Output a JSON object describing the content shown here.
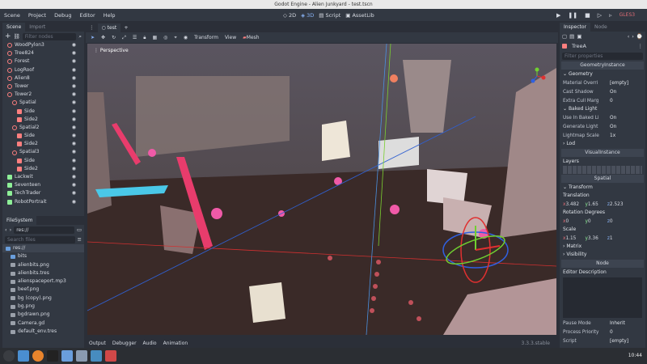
{
  "window": {
    "title": "Godot Engine - Alien Junkyard - test.tscn"
  },
  "menu": [
    "Scene",
    "Project",
    "Debug",
    "Editor",
    "Help"
  ],
  "modes": {
    "m2d": "2D",
    "m3d": "3D",
    "script": "Script",
    "assetlib": "AssetLib"
  },
  "renderer": "GLES3",
  "scene_dock": {
    "tab_scene": "Scene",
    "tab_import": "Import",
    "filter_placeholder": "Filter nodes",
    "nodes": [
      {
        "name": "WoodPylon3",
        "indent": 1,
        "icon": "spatial"
      },
      {
        "name": "Tree824",
        "indent": 1,
        "icon": "spatial"
      },
      {
        "name": "Forest",
        "indent": 1,
        "icon": "spatial"
      },
      {
        "name": "LogRoof",
        "indent": 1,
        "icon": "spatial"
      },
      {
        "name": "Alien8",
        "indent": 1,
        "icon": "spatial"
      },
      {
        "name": "Tower",
        "indent": 1,
        "icon": "spatial"
      },
      {
        "name": "Tower2",
        "indent": 1,
        "icon": "spatial"
      },
      {
        "name": "Spatial",
        "indent": 2,
        "icon": "spatial"
      },
      {
        "name": "Side",
        "indent": 3,
        "icon": "sprite"
      },
      {
        "name": "Side2",
        "indent": 3,
        "icon": "sprite"
      },
      {
        "name": "Spatial2",
        "indent": 2,
        "icon": "spatial"
      },
      {
        "name": "Side",
        "indent": 3,
        "icon": "sprite"
      },
      {
        "name": "Side2",
        "indent": 3,
        "icon": "sprite"
      },
      {
        "name": "Spatial3",
        "indent": 2,
        "icon": "spatial"
      },
      {
        "name": "Side",
        "indent": 3,
        "icon": "sprite"
      },
      {
        "name": "Side2",
        "indent": 3,
        "icon": "sprite"
      },
      {
        "name": "Lackwit",
        "indent": 1,
        "icon": "control"
      },
      {
        "name": "Seventeen",
        "indent": 1,
        "icon": "control"
      },
      {
        "name": "TechTrader",
        "indent": 1,
        "icon": "control"
      },
      {
        "name": "RobotPortrait",
        "indent": 1,
        "icon": "control"
      }
    ]
  },
  "filesystem": {
    "title": "FileSystem",
    "path": "res://",
    "search_placeholder": "Search files",
    "files": [
      "res://",
      "bits",
      "alienbits.png",
      "alienbits.tres",
      "alienspaceport.mp3",
      "beef.png",
      "bg (copy).png",
      "bg.png",
      "bgdrawn.png",
      "Camera.gd",
      "default_env.tres"
    ]
  },
  "viewport": {
    "tab": "test",
    "perspective": "Perspective",
    "menus": [
      "Transform",
      "View",
      "Mesh"
    ]
  },
  "bottom_panel": {
    "tabs": [
      "Output",
      "Debugger",
      "Audio",
      "Animation"
    ],
    "version": "3.3.3.stable"
  },
  "inspector": {
    "tab_inspector": "Inspector",
    "tab_node": "Node",
    "node_name": "TreeA",
    "filter_placeholder": "Filter properties",
    "class_geometry": "GeometryInstance",
    "geometry": "Geometry",
    "props1": [
      {
        "k": "Material Overri",
        "v": "[empty]"
      },
      {
        "k": "Cast Shadow",
        "v": "On"
      },
      {
        "k": "Extra Cull Marg",
        "v": "0"
      }
    ],
    "baked_light": "Baked Light",
    "props2": [
      {
        "k": "Use In Baked Li",
        "v": "On"
      },
      {
        "k": "Generate Light",
        "v": "On"
      },
      {
        "k": "Lightmap Scale",
        "v": "1x"
      }
    ],
    "lod": "Lod",
    "class_visual": "VisualInstance",
    "layers": "Layers",
    "class_spatial": "Spatial",
    "transform": "Transform",
    "translation": "Translation",
    "tx": "3.482",
    "ty": "1.65",
    "tz": "2.523",
    "rotation": "Rotation Degrees",
    "rx": "0",
    "ry": "0",
    "rz": "0",
    "scale": "Scale",
    "sx": "1.15",
    "sy": "3.36",
    "sz": "1",
    "matrix": "Matrix",
    "visibility": "Visibility",
    "class_node": "Node",
    "editor_desc": "Editor Description",
    "props3": [
      {
        "k": "Pause Mode",
        "v": "Inherit"
      },
      {
        "k": "Process Priority",
        "v": "0"
      },
      {
        "k": "Script",
        "v": "[empty]"
      }
    ]
  },
  "clock": "10:44"
}
